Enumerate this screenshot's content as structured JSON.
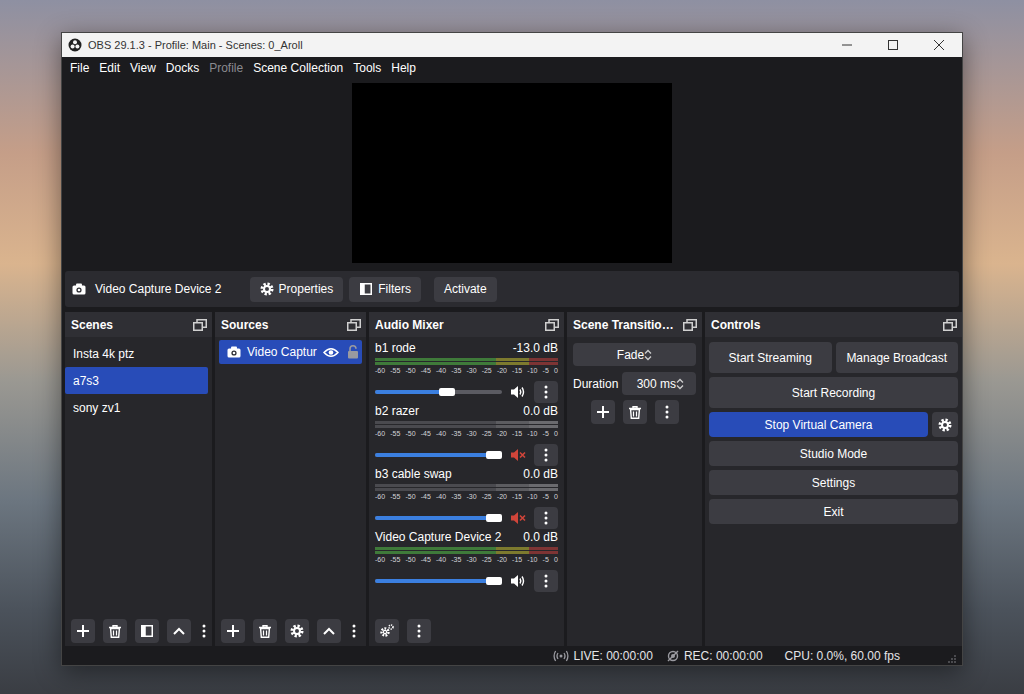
{
  "window": {
    "title": "OBS 29.1.3 - Profile: Main - Scenes: 0_Aroll"
  },
  "menu": [
    {
      "label": "File",
      "disabled": false
    },
    {
      "label": "Edit",
      "disabled": false
    },
    {
      "label": "View",
      "disabled": false
    },
    {
      "label": "Docks",
      "disabled": false
    },
    {
      "label": "Profile",
      "disabled": true
    },
    {
      "label": "Scene Collection",
      "disabled": false
    },
    {
      "label": "Tools",
      "disabled": false
    },
    {
      "label": "Help",
      "disabled": false
    }
  ],
  "source_toolbar": {
    "source": "Video Capture Device 2",
    "buttons": [
      "Properties",
      "Filters",
      "Activate"
    ]
  },
  "scenes": {
    "title": "Scenes",
    "items": [
      {
        "label": "Insta 4k ptz",
        "selected": false
      },
      {
        "label": "a7s3",
        "selected": true
      },
      {
        "label": "sony zv1",
        "selected": false
      }
    ]
  },
  "sources": {
    "title": "Sources",
    "items": [
      {
        "label": "Video Captur",
        "selected": true,
        "visible": true,
        "locked": false
      }
    ]
  },
  "audio_mixer": {
    "title": "Audio Mixer",
    "scale": [
      "-60",
      "-55",
      "-50",
      "-45",
      "-40",
      "-35",
      "-30",
      "-25",
      "-20",
      "-15",
      "-10",
      "-5",
      "0"
    ],
    "channels": [
      {
        "name": "b1 rode",
        "reading": "-13.0 dB",
        "level": 0.58,
        "muted": false
      },
      {
        "name": "b2 razer",
        "reading": "0.0 dB",
        "level": 1,
        "muted": true
      },
      {
        "name": "b3 cable swap",
        "reading": "0.0 dB",
        "level": 1,
        "muted": true
      },
      {
        "name": "Video Capture Device 2",
        "reading": "0.0 dB",
        "level": 1,
        "muted": false
      }
    ]
  },
  "scene_transitions": {
    "title": "Scene Transitio…",
    "transition": "Fade",
    "duration_label": "Duration",
    "duration": "300 ms"
  },
  "controls": {
    "title": "Controls",
    "rows": [
      [
        {
          "label": "Start Streaming",
          "active": false,
          "kind": "plain"
        },
        {
          "label": "Manage Broadcast",
          "active": false,
          "kind": "plain"
        }
      ],
      [
        {
          "label": "Start Recording",
          "active": false,
          "kind": "plain"
        }
      ],
      [
        {
          "label": "Stop Virtual Camera",
          "active": true,
          "kind": "split"
        }
      ],
      [
        {
          "label": "Studio Mode",
          "active": false,
          "kind": "plain"
        }
      ],
      [
        {
          "label": "Settings",
          "active": false,
          "kind": "plain"
        }
      ],
      [
        {
          "label": "Exit",
          "active": false,
          "kind": "plain"
        }
      ]
    ]
  },
  "status_bar": {
    "live": "LIVE: 00:00:00",
    "rec": "REC: 00:00:00",
    "cpu": "CPU: 0.0%, 60.00 fps"
  }
}
